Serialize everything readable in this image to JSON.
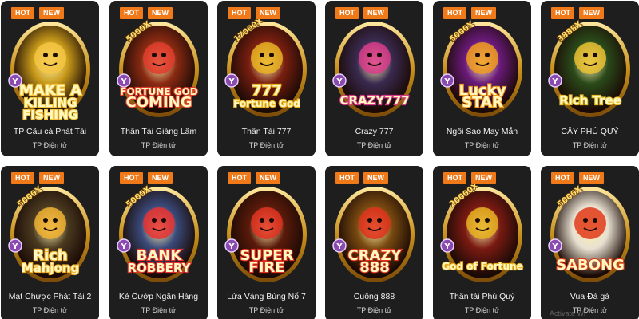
{
  "badges": {
    "hot": "HOT",
    "new": "NEW"
  },
  "games": [
    {
      "title": "TP Câu cá Phát Tài",
      "provider": "TP Điện tử",
      "logo_lines": [
        "MAKE A",
        "KILLING",
        "FISHING"
      ],
      "icon": "golden-sun-icon",
      "accent": "#f5c542",
      "bg": "#c89a1a"
    },
    {
      "title": "Thần Tài Giáng Lâm",
      "provider": "TP Điện tử",
      "logo_lines": [
        "FORTUNE GOD",
        "COMING"
      ],
      "multiplier": "5000X",
      "icon": "fortune-god-icon",
      "accent": "#e23a2a",
      "bg": "#8a2a12"
    },
    {
      "title": "Thần Tài 777",
      "provider": "TP Điện tử",
      "logo_lines": [
        "777",
        "Fortune God"
      ],
      "multiplier": "17000X",
      "icon": "fortune-god-777-icon",
      "accent": "#e8b020",
      "bg": "#7a1f10"
    },
    {
      "title": "Crazy 777",
      "provider": "TP Điện tử",
      "logo_lines": [
        "CRAZY777"
      ],
      "icon": "slot-machine-icon",
      "accent": "#d83a8a",
      "bg": "#3a2a50"
    },
    {
      "title": "Ngôi Sao May Mắn",
      "provider": "TP Điện tử",
      "logo_lines": [
        "Lucky",
        "STAR"
      ],
      "multiplier": "5000X",
      "icon": "lucky-star-icon",
      "accent": "#f09a20",
      "bg": "#6a1a7a"
    },
    {
      "title": "CÂY PHÚ QUÝ",
      "provider": "TP Điện tử",
      "logo_lines": [
        "Rich Tree"
      ],
      "multiplier": "3888X",
      "icon": "money-tree-icon",
      "accent": "#e8c030",
      "bg": "#2a4a1a"
    },
    {
      "title": "Mạt Chược Phát Tài 2",
      "provider": "TP Điện tử",
      "logo_lines": [
        "Rich",
        "Mahjong"
      ],
      "multiplier": "5000X",
      "icon": "mahjong-god-icon",
      "accent": "#f0b030",
      "bg": "#4a3a20"
    },
    {
      "title": "Kẻ Cướp Ngân Hàng",
      "provider": "TP Điện tử",
      "logo_lines": [
        "BANK",
        "ROBBERY"
      ],
      "multiplier": "5000X",
      "icon": "robber-icon",
      "accent": "#e83030",
      "bg": "#3a4a7a"
    },
    {
      "title": "Lửa Vàng Bùng Nổ 7",
      "provider": "TP Điện tử",
      "logo_lines": [
        "SUPER",
        "FIRE"
      ],
      "icon": "fire-seven-icon",
      "accent": "#e03020",
      "bg": "#5a1a0a"
    },
    {
      "title": "Cuồng 888",
      "provider": "TP Điện tử",
      "logo_lines": [
        "CRAZY",
        "888"
      ],
      "icon": "crazy-888-icon",
      "accent": "#e0301a",
      "bg": "#7a4a10"
    },
    {
      "title": "Thần tài Phú Quý",
      "provider": "TP Điện tử",
      "logo_lines": [
        "God of Fortune"
      ],
      "multiplier": "20000X",
      "icon": "god-of-fortune-icon",
      "accent": "#e8b020",
      "bg": "#7a1a12"
    },
    {
      "title": "Vua Đá gà",
      "provider": "TP Điện tử",
      "logo_lines": [
        "SABONG"
      ],
      "multiplier": "5000X",
      "icon": "rooster-icon",
      "accent": "#e03a1a",
      "bg": "#e8e0d0"
    }
  ],
  "provider_badge": "Y",
  "overlay_text": "Activate Wi"
}
